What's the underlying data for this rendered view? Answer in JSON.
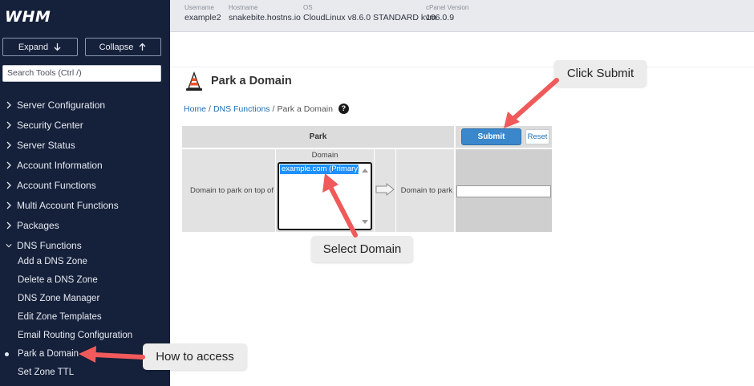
{
  "sidebar": {
    "logo": "WHM",
    "expand_label": "Expand",
    "collapse_label": "Collapse",
    "search_placeholder": "Search Tools (Ctrl /)",
    "categories": [
      {
        "label": "Server Configuration"
      },
      {
        "label": "Security Center"
      },
      {
        "label": "Server Status"
      },
      {
        "label": "Account Information"
      },
      {
        "label": "Account Functions"
      },
      {
        "label": "Multi Account Functions"
      },
      {
        "label": "Packages"
      },
      {
        "label": "DNS Functions"
      }
    ],
    "dns_items": [
      {
        "label": "Add a DNS Zone"
      },
      {
        "label": "Delete a DNS Zone"
      },
      {
        "label": "DNS Zone Manager"
      },
      {
        "label": "Edit Zone Templates"
      },
      {
        "label": "Email Routing Configuration"
      },
      {
        "label": "Park a Domain"
      },
      {
        "label": "Set Zone TTL"
      }
    ]
  },
  "topbar": {
    "username_key": "Username",
    "username": "example2",
    "hostname_key": "Hostname",
    "hostname": "snakebite.hostns.io",
    "os_key": "OS",
    "os": "CloudLinux v8.6.0 STANDARD kvm",
    "cpanel_key": "cPanel Version",
    "cpanel": "106.0.9"
  },
  "page": {
    "title": "Park a Domain",
    "breadcrumb": [
      "Home",
      "DNS Functions",
      "Park a Domain"
    ],
    "help_icon": "?"
  },
  "form": {
    "park_header": "Park",
    "submit_label": "Submit",
    "reset_label": "Reset",
    "domain_to_park_on_label": "Domain to park on top of",
    "domain_header": "Domain",
    "selected_domain": "example.com (Primary)",
    "domain_to_park_label": "Domain to park",
    "domain_to_park_value": ""
  },
  "callouts": {
    "submit": "Click Submit",
    "domain": "Select Domain",
    "access": "How to access"
  },
  "colors": {
    "sidebar_bg": "#15203a",
    "submit_bg": "#3a87cc",
    "selection": "#1e90ff",
    "arrow": "#f05a5a"
  }
}
